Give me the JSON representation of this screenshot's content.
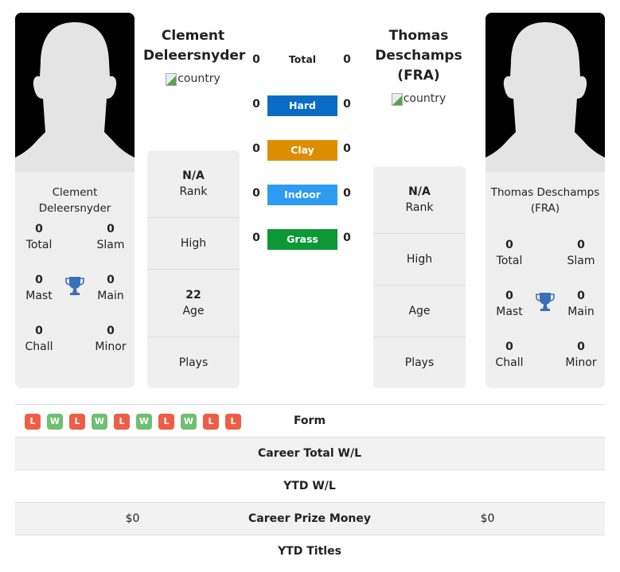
{
  "player1": {
    "header_name": "Clement Deleersnyder",
    "country_alt": "country",
    "card_name": "Clement Deleersnyder",
    "titles": {
      "total": {
        "value": "0",
        "label": "Total"
      },
      "slam": {
        "value": "0",
        "label": "Slam"
      },
      "mast": {
        "value": "0",
        "label": "Mast"
      },
      "main": {
        "value": "0",
        "label": "Main"
      },
      "chall": {
        "value": "0",
        "label": "Chall"
      },
      "minor": {
        "value": "0",
        "label": "Minor"
      }
    },
    "info": {
      "rank": {
        "value": "N/A",
        "label": "Rank"
      },
      "high": {
        "value": "",
        "label": "High"
      },
      "age": {
        "value": "22",
        "label": "Age"
      },
      "plays": {
        "value": "",
        "label": "Plays"
      }
    }
  },
  "player2": {
    "header_name": "Thomas Deschamps (FRA)",
    "country_alt": "country",
    "card_name": "Thomas Deschamps (FRA)",
    "titles": {
      "total": {
        "value": "0",
        "label": "Total"
      },
      "slam": {
        "value": "0",
        "label": "Slam"
      },
      "mast": {
        "value": "0",
        "label": "Mast"
      },
      "main": {
        "value": "0",
        "label": "Main"
      },
      "chall": {
        "value": "0",
        "label": "Chall"
      },
      "minor": {
        "value": "0",
        "label": "Minor"
      }
    },
    "info": {
      "rank": {
        "value": "N/A",
        "label": "Rank"
      },
      "high": {
        "value": "",
        "label": "High"
      },
      "age": {
        "value": "",
        "label": "Age"
      },
      "plays": {
        "value": "",
        "label": "Plays"
      }
    }
  },
  "h2h": {
    "total": {
      "label": "Total",
      "left": "0",
      "right": "0"
    },
    "surfaces": [
      {
        "label": "Hard",
        "left": "0",
        "right": "0",
        "color": "#0a6cc4"
      },
      {
        "label": "Clay",
        "left": "0",
        "right": "0",
        "color": "#dd8e00"
      },
      {
        "label": "Indoor",
        "left": "0",
        "right": "0",
        "color": "#2d9cf2"
      },
      {
        "label": "Grass",
        "left": "0",
        "right": "0",
        "color": "#0d9737"
      }
    ]
  },
  "form": {
    "label": "Form",
    "player1": [
      "L",
      "W",
      "L",
      "W",
      "L",
      "W",
      "L",
      "W",
      "L",
      "L"
    ],
    "colors": {
      "W": "#6fbf73",
      "L": "#ee5e45"
    }
  },
  "comparison": [
    {
      "label": "Career Total W/L",
      "left": "",
      "right": ""
    },
    {
      "label": "YTD W/L",
      "left": "",
      "right": ""
    },
    {
      "label": "Career Prize Money",
      "left": "$0",
      "right": "$0"
    },
    {
      "label": "YTD Titles",
      "left": "",
      "right": ""
    }
  ],
  "colors": {
    "trophy": "#3a6fba"
  }
}
